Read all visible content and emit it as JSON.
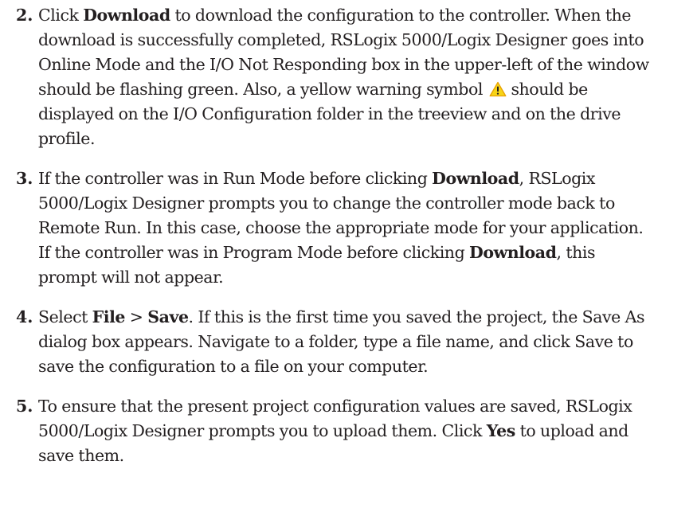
{
  "steps": [
    {
      "number": "2.",
      "t1": "Click ",
      "b1": "Download",
      "t2": " to download the configuration to the controller. When the download is successfully completed, RSLogix 5000/Logix Designer goes into Online Mode and the I/O Not Responding box in the upper-left of the window should be flashing green. Also, a yellow warning symbol ",
      "icon": "warning-triangle-icon",
      "t3": " should be displayed on the I/O Configuration folder in the treeview and on the drive profile."
    },
    {
      "number": "3.",
      "t1": "If the controller was in Run Mode before clicking ",
      "b1": "Download",
      "t2": ", RSLogix 5000/Logix Designer prompts you to change the controller mode back to Remote Run. In this case, choose the appropriate mode for your application. If the controller was in Program Mode before clicking ",
      "b2": "Download",
      "t3": ", this prompt will not appear."
    },
    {
      "number": "4.",
      "t1": "Select ",
      "b1": "File",
      "t2": " > ",
      "b2": "Save",
      "t3": ". If this is the first time you saved the project, the Save As dialog box appears. Navigate to a folder, type a file name, and click Save to save the configuration to a file on your computer."
    },
    {
      "number": "5.",
      "t1": "To ensure that the present project configuration values are saved, RSLogix 5000/Logix Designer prompts you to upload them. Click ",
      "b1": "Yes",
      "t2": " to upload and save them."
    }
  ],
  "colors": {
    "text": "#231f20",
    "warning_fill": "#f7d417",
    "warning_stroke": "#e8a100"
  }
}
